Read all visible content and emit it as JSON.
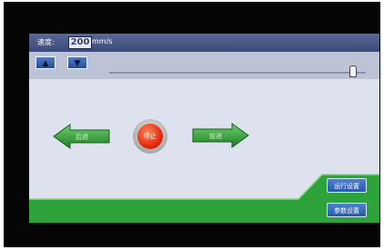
{
  "header": {
    "speed_label": "速度:",
    "speed_value": "200",
    "speed_unit": "mm/s"
  },
  "controls": {
    "up_icon": "▲",
    "down_icon": "▼",
    "slider_level": 0.95
  },
  "center": {
    "back_label": "后退",
    "stop_label": "停止",
    "forward_label": "前进"
  },
  "side_buttons": {
    "settings_1": "运行设置",
    "settings_2": "参数设置"
  },
  "colors": {
    "green": "#2ea33c",
    "header": "#465487",
    "button_blue": "#3a6ec0",
    "stop_red": "#e82a10"
  }
}
